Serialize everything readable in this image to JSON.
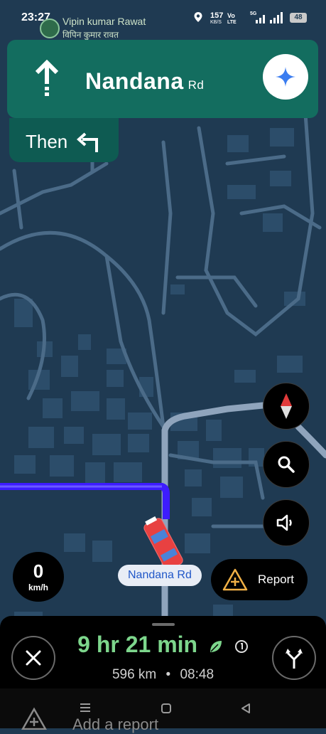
{
  "status_bar": {
    "time": "23:27",
    "notification_name": "Vipin kumar Rawat",
    "notification_sub": "विपिन कुमार रावत",
    "speed_top": "157",
    "speed_bottom": "KB/S",
    "volte_top": "Vo",
    "volte_bottom": "LTE",
    "signal_tag": "5G",
    "battery": "48"
  },
  "navigation": {
    "street_name": "Nandana",
    "street_suffix": "Rd",
    "then_label": "Then",
    "maneuver_icon": "straight-arrow-icon",
    "then_icon": "turn-left-icon"
  },
  "map": {
    "road_label": "Nandana Rd",
    "route_color": "#3d1cff",
    "background_color": "#1f3a52"
  },
  "controls": {
    "speed_value": "0",
    "speed_unit": "km/h",
    "report_label": "Report"
  },
  "trip": {
    "eta_duration": "9 hr 21 min",
    "distance": "596 km",
    "separator": "•",
    "arrival_time": "08:48"
  },
  "bottom": {
    "add_report_label": "Add a report"
  }
}
